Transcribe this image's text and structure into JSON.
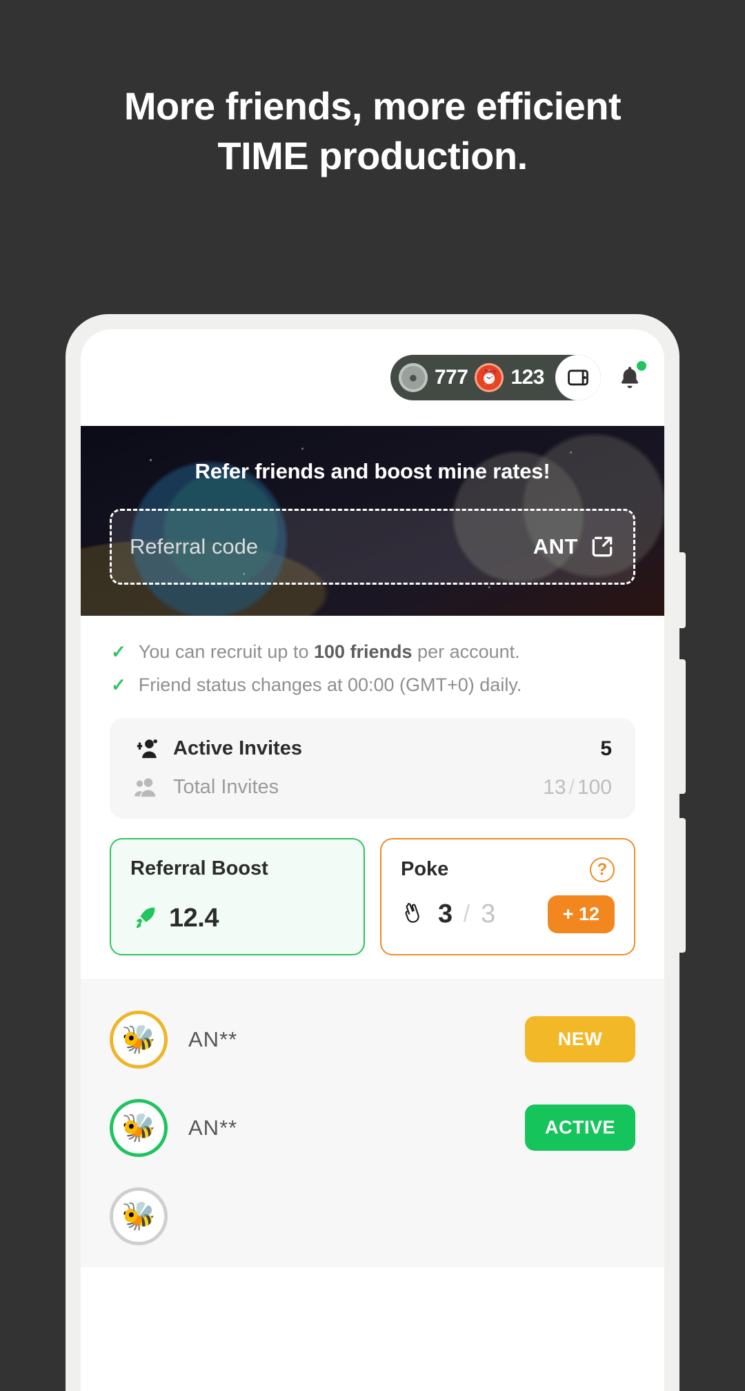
{
  "promo": {
    "heading_line1": "More friends, more efficient",
    "heading_line2": "TIME production."
  },
  "colors": {
    "page_bg": "#333333",
    "accent_green": "#2ec45f",
    "accent_orange": "#f2871f",
    "accent_yellow": "#f3b827",
    "pill_dark": "#434a44",
    "time_red": "#e8431f"
  },
  "topbar": {
    "ant_balance": "777",
    "time_balance": "123",
    "ant_icon": "ant-coin-icon",
    "time_icon": "alarm-clock-icon",
    "wallet_icon": "wallet-icon",
    "bell_icon": "bell-icon",
    "bell_has_unread": true
  },
  "banner": {
    "title": "Refer friends and boost mine rates!",
    "input_placeholder": "Referral code",
    "input_value": "",
    "action_label": "ANT",
    "action_icon": "external-link-icon"
  },
  "info": {
    "items": [
      {
        "icon": "check-icon",
        "prefix": "You can recruit up to ",
        "bold": "100 friends",
        "suffix": " per account."
      },
      {
        "icon": "check-icon",
        "prefix": "Friend status changes at 00:00 (GMT+0) daily.",
        "bold": "",
        "suffix": ""
      }
    ]
  },
  "invites": {
    "active": {
      "icon": "add-person-icon",
      "label": "Active Invites",
      "value": "5"
    },
    "total": {
      "icon": "people-icon",
      "label": "Total Invites",
      "value": "13",
      "max": "100",
      "separator": "/"
    }
  },
  "stats": {
    "boost": {
      "title": "Referral Boost",
      "icon": "rocket-icon",
      "value": "12.4"
    },
    "poke": {
      "title": "Poke",
      "help_icon": "question-mark-icon",
      "icon": "poke-hand-icon",
      "value": "3",
      "max": "3",
      "separator": "/",
      "badge": "+ 12"
    }
  },
  "friends": {
    "rows": [
      {
        "avatar": "ant-avatar-icon",
        "name": "AN**",
        "status": "NEW",
        "status_kind": "new"
      },
      {
        "avatar": "ant-avatar-icon",
        "name": "AN**",
        "status": "ACTIVE",
        "status_kind": "active"
      },
      {
        "avatar": "ant-avatar-icon",
        "name": "",
        "status": "",
        "status_kind": "dim"
      }
    ]
  }
}
